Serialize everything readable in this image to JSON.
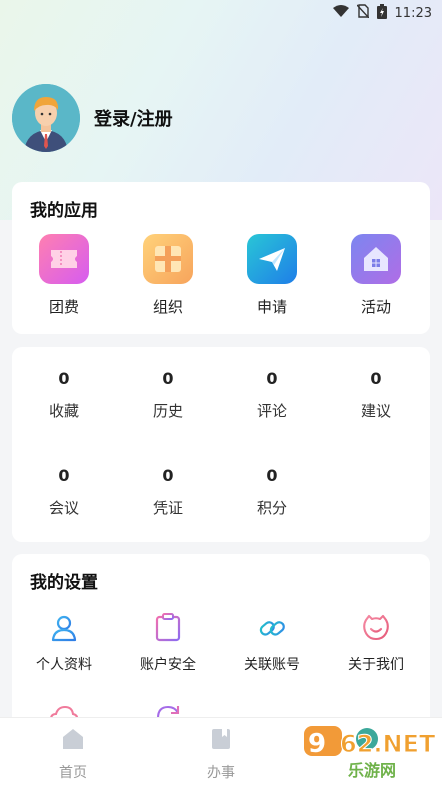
{
  "status_bar": {
    "time": "11:23"
  },
  "profile": {
    "login_label": "登录/注册"
  },
  "my_apps": {
    "title": "我的应用",
    "items": [
      {
        "label": "团费",
        "icon": "ticket-icon"
      },
      {
        "label": "组织",
        "icon": "package-icon"
      },
      {
        "label": "申请",
        "icon": "paper-plane-icon"
      },
      {
        "label": "活动",
        "icon": "house-icon"
      }
    ]
  },
  "stats": {
    "items": [
      {
        "value": "0",
        "label": "收藏"
      },
      {
        "value": "0",
        "label": "历史"
      },
      {
        "value": "0",
        "label": "评论"
      },
      {
        "value": "0",
        "label": "建议"
      },
      {
        "value": "0",
        "label": "会议"
      },
      {
        "value": "0",
        "label": "凭证"
      },
      {
        "value": "0",
        "label": "积分"
      }
    ]
  },
  "my_settings": {
    "title": "我的设置",
    "items": [
      {
        "label": "个人资料",
        "icon": "user-icon"
      },
      {
        "label": "账户安全",
        "icon": "clipboard-icon"
      },
      {
        "label": "关联账号",
        "icon": "link-icon"
      },
      {
        "label": "关于我们",
        "icon": "smile-icon"
      }
    ]
  },
  "tabbar": {
    "items": [
      {
        "label": "首页",
        "icon": "home-icon"
      },
      {
        "label": "办事",
        "icon": "book-icon"
      }
    ]
  },
  "watermark": {
    "text_main": "962.NET",
    "text_sub": "乐游网"
  }
}
